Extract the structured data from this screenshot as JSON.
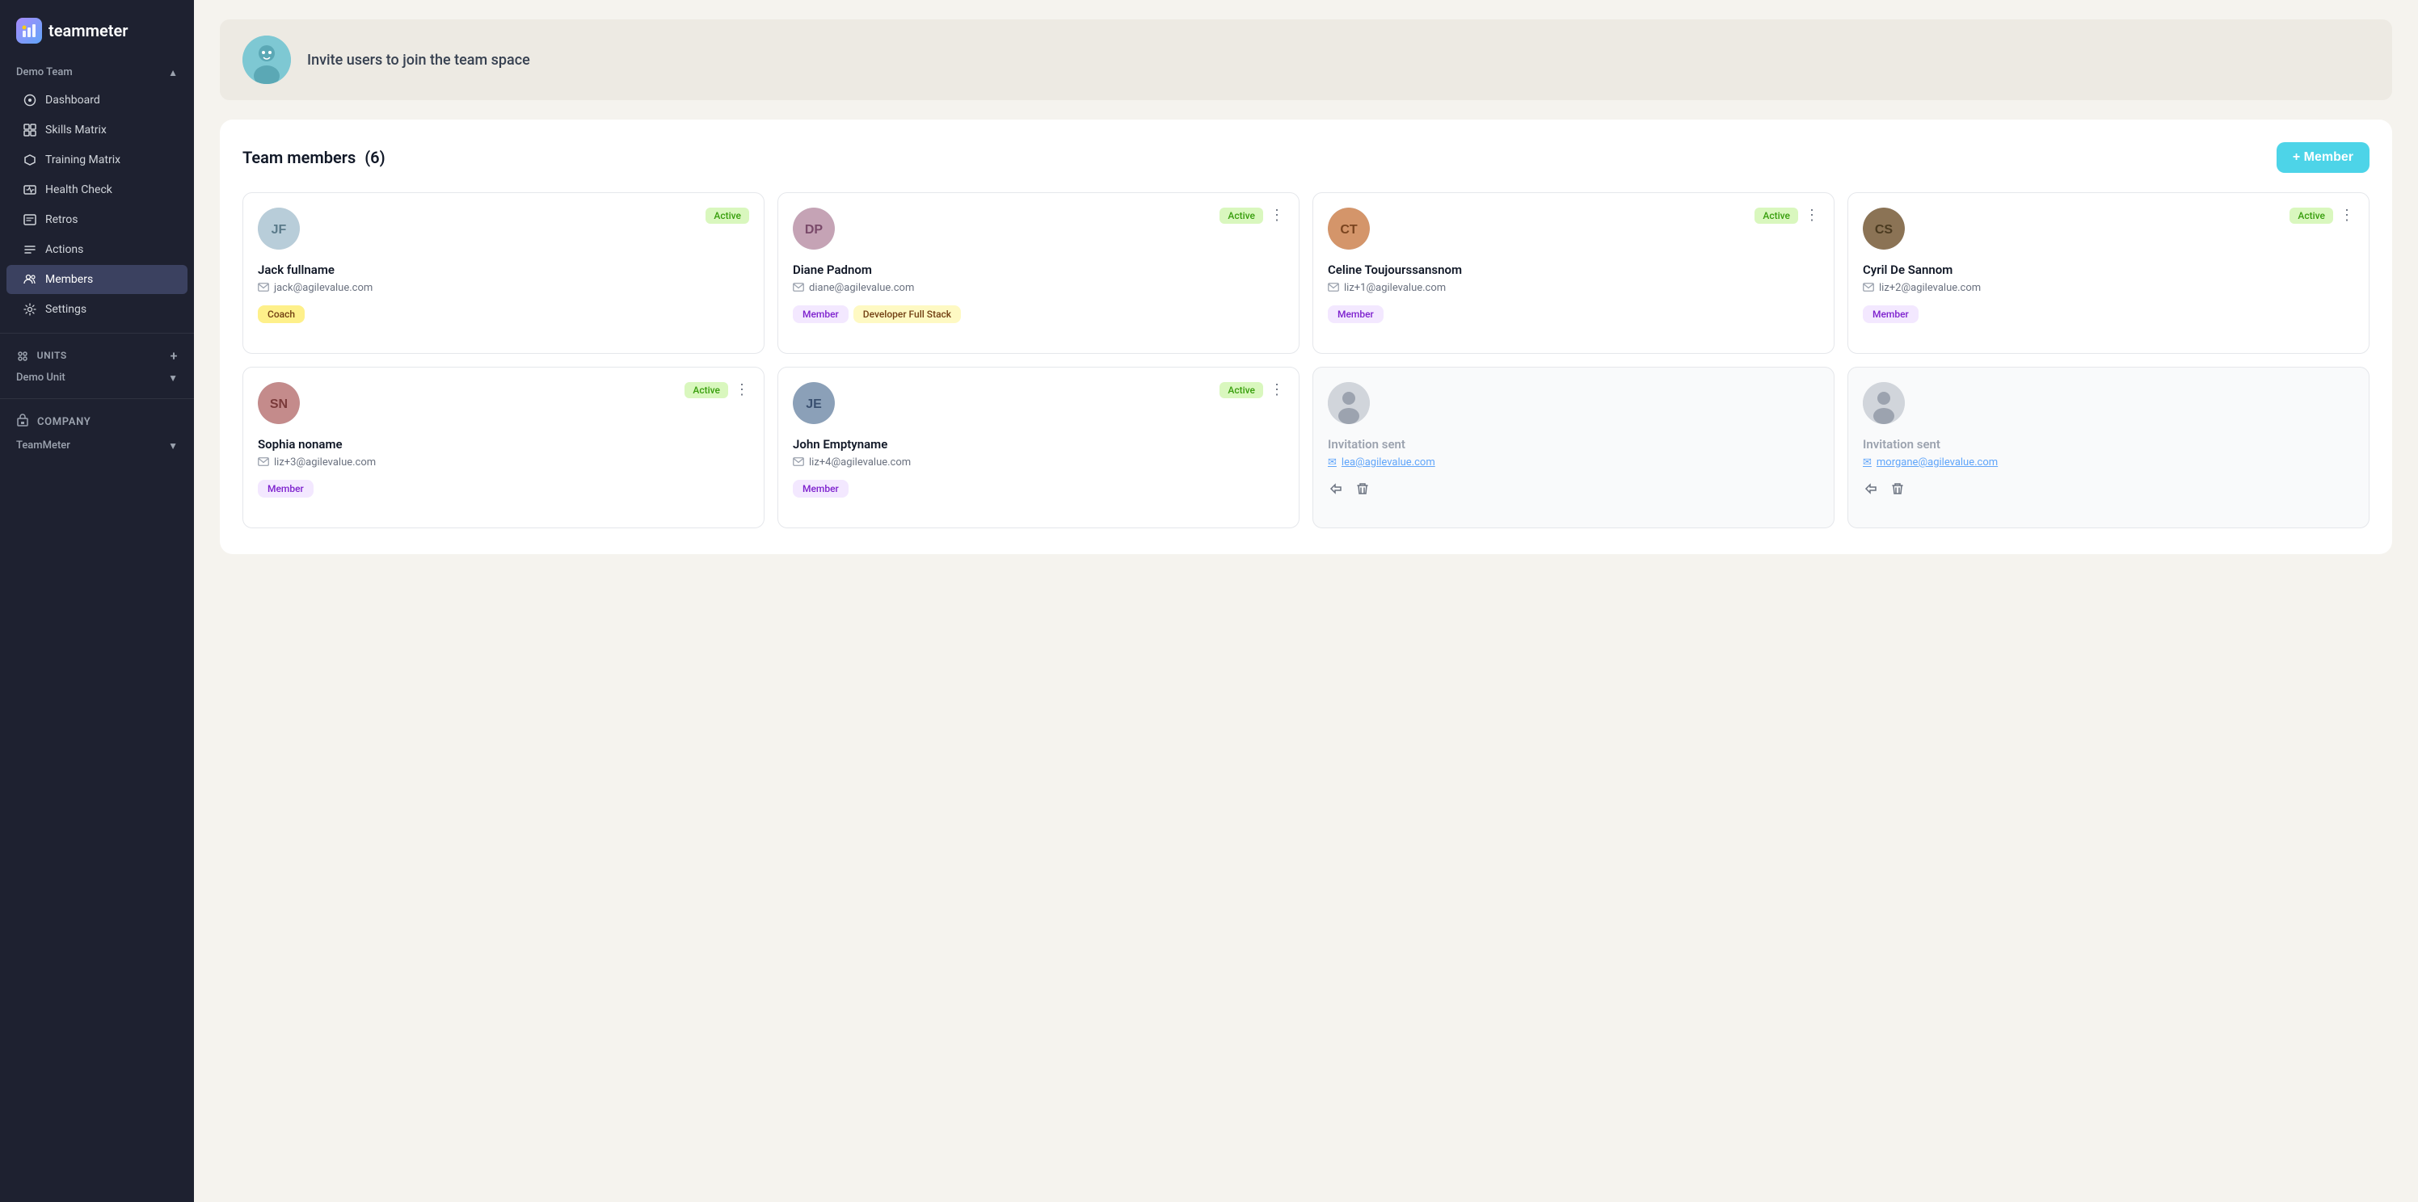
{
  "app": {
    "name": "teammeter",
    "logo_icon": "⚡"
  },
  "sidebar": {
    "team_section": {
      "label": "Demo Team",
      "chevron": "▲"
    },
    "nav_items": [
      {
        "id": "dashboard",
        "icon": "◎",
        "label": "Dashboard",
        "active": false
      },
      {
        "id": "skills-matrix",
        "icon": "⊞",
        "label": "Skills Matrix",
        "active": false
      },
      {
        "id": "training-matrix",
        "icon": "◇",
        "label": "Training Matrix",
        "active": false
      },
      {
        "id": "health-check",
        "icon": "▣",
        "label": "Health Check",
        "active": false
      },
      {
        "id": "retros",
        "icon": "▥",
        "label": "Retros",
        "active": false
      },
      {
        "id": "actions",
        "icon": "≡",
        "label": "Actions",
        "active": false
      },
      {
        "id": "members",
        "icon": "👥",
        "label": "Members",
        "active": true
      },
      {
        "id": "settings",
        "icon": "⚙",
        "label": "Settings",
        "active": false
      }
    ],
    "units_section": {
      "label": "UNITS",
      "plus": "+"
    },
    "demo_unit": {
      "label": "Demo Unit",
      "chevron": "▼"
    },
    "company": {
      "icon": "🏢",
      "label": "COMPANY"
    },
    "teammeter": {
      "label": "TeamMeter",
      "chevron": "▼"
    }
  },
  "invite_banner": {
    "avatar_emoji": "🧑",
    "text": "Invite users to join the team space"
  },
  "team_members": {
    "title": "Team members",
    "count": "(6)",
    "add_button": "+ Member",
    "members": [
      {
        "id": "jack",
        "name": "Jack fullname",
        "email": "jack@agilevalue.com",
        "status": "Active",
        "tags": [
          "Coach"
        ],
        "avatar_color": "#b8cdd9",
        "avatar_initials": "JF",
        "has_menu": false,
        "type": "member"
      },
      {
        "id": "diane",
        "name": "Diane Padnom",
        "email": "diane@agilevalue.com",
        "status": "Active",
        "tags": [
          "Member",
          "Developer Full Stack"
        ],
        "avatar_color": "#c5a3b5",
        "avatar_initials": "DP",
        "has_menu": true,
        "type": "member"
      },
      {
        "id": "celine",
        "name": "Celine Toujourssansnom",
        "email": "liz+1@agilevalue.com",
        "status": "Active",
        "tags": [
          "Member"
        ],
        "avatar_color": "#d4956a",
        "avatar_initials": "CT",
        "has_menu": true,
        "type": "member"
      },
      {
        "id": "cyril",
        "name": "Cyril De Sannom",
        "email": "liz+2@agilevalue.com",
        "status": "Active",
        "tags": [
          "Member"
        ],
        "avatar_color": "#8b7355",
        "avatar_initials": "CS",
        "has_menu": true,
        "type": "member"
      },
      {
        "id": "sophia",
        "name": "Sophia noname",
        "email": "liz+3@agilevalue.com",
        "status": "Active",
        "tags": [
          "Member"
        ],
        "avatar_color": "#c48b8b",
        "avatar_initials": "SN",
        "has_menu": true,
        "type": "member"
      },
      {
        "id": "john",
        "name": "John Emptyname",
        "email": "liz+4@agilevalue.com",
        "status": "Active",
        "tags": [
          "Member"
        ],
        "avatar_color": "#8ba0b8",
        "avatar_initials": "JE",
        "has_menu": true,
        "type": "member"
      },
      {
        "id": "invite1",
        "name": "Invitation sent",
        "email": "lea@agilevalue.com",
        "status": "",
        "tags": [],
        "avatar_color": "#d1d5db",
        "avatar_initials": "",
        "has_menu": false,
        "type": "invitation"
      },
      {
        "id": "invite2",
        "name": "Invitation sent",
        "email": "morgane@agilevalue.com",
        "status": "",
        "tags": [],
        "avatar_color": "#d1d5db",
        "avatar_initials": "",
        "has_menu": false,
        "type": "invitation"
      }
    ]
  }
}
